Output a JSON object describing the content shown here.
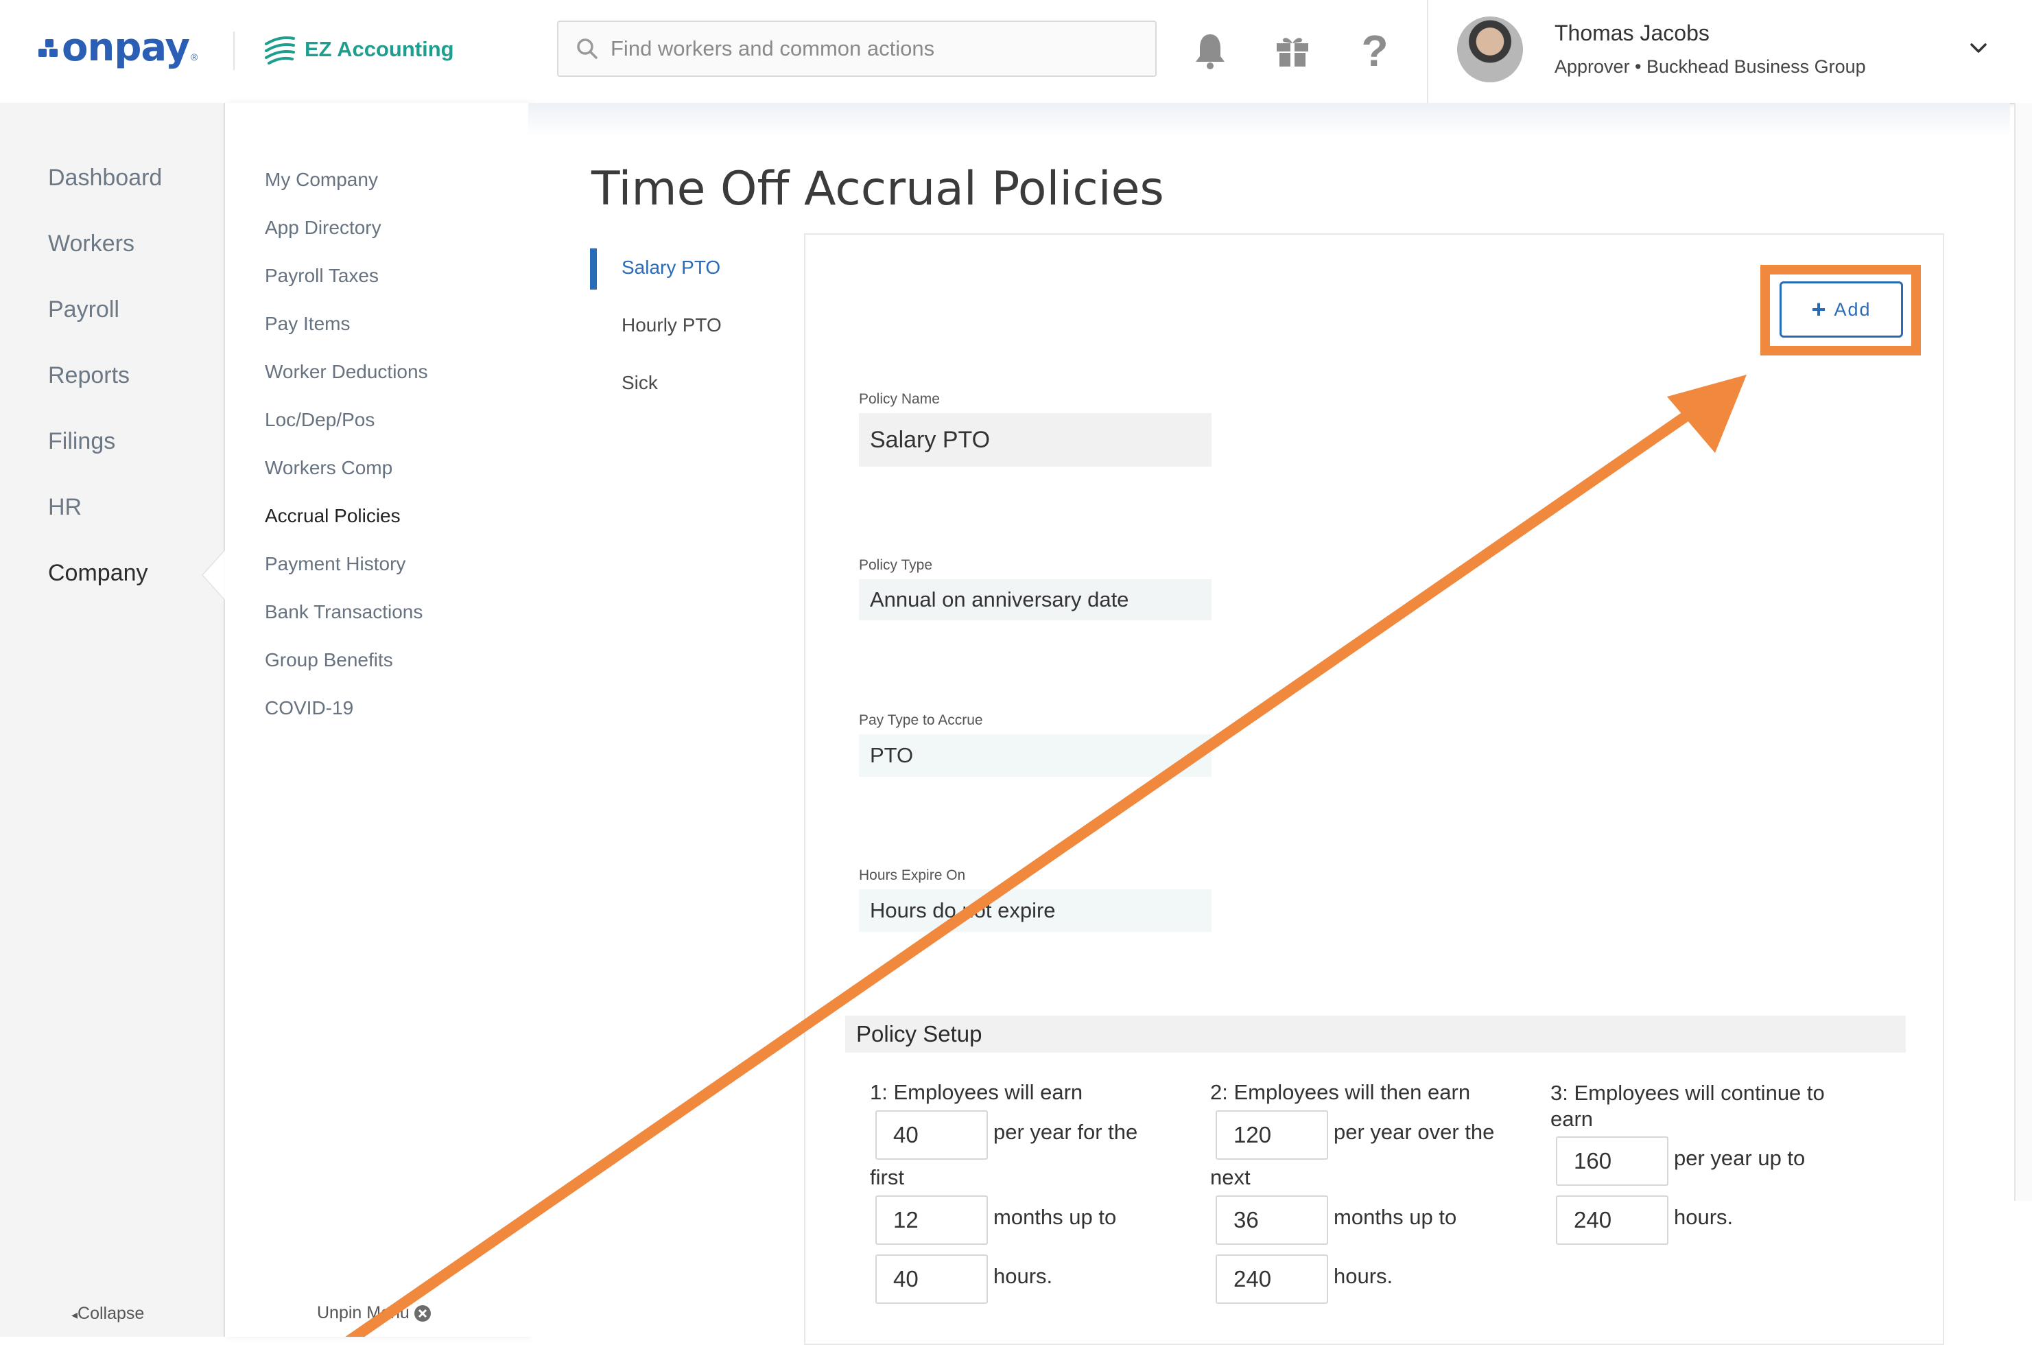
{
  "header": {
    "onpay_logo": "onpay",
    "onpay_logo_reg": "®",
    "ez_logo": "EZ Accounting",
    "search_placeholder": "Find workers and common actions",
    "icons": [
      "bell-icon",
      "gift-icon",
      "help-icon"
    ],
    "help_glyph": "?",
    "user_name": "Thomas Jacobs",
    "user_role": "Approver • Buckhead Business Group"
  },
  "nav_primary": {
    "items": [
      {
        "label": "Dashboard"
      },
      {
        "label": "Workers"
      },
      {
        "label": "Payroll"
      },
      {
        "label": "Reports"
      },
      {
        "label": "Filings"
      },
      {
        "label": "HR"
      },
      {
        "label": "Company"
      }
    ],
    "active": "Company",
    "collapse_label": "Collapse"
  },
  "nav_secondary": {
    "items": [
      {
        "label": "My Company"
      },
      {
        "label": "App Directory"
      },
      {
        "label": "Payroll Taxes"
      },
      {
        "label": "Pay Items"
      },
      {
        "label": "Worker Deductions"
      },
      {
        "label": "Loc/Dep/Pos"
      },
      {
        "label": "Workers Comp"
      },
      {
        "label": "Accrual Policies"
      },
      {
        "label": "Payment History"
      },
      {
        "label": "Bank Transactions"
      },
      {
        "label": "Group Benefits"
      },
      {
        "label": "COVID-19"
      }
    ],
    "active": "Accrual Policies",
    "unpin_label": "Unpin Menu"
  },
  "main": {
    "title": "Time Off Accrual Policies",
    "policy_tabs": [
      {
        "label": "Salary PTO"
      },
      {
        "label": "Hourly PTO"
      },
      {
        "label": "Sick"
      }
    ],
    "active_tab": "Salary PTO",
    "add_button": "Add",
    "fields": {
      "policy_name": {
        "label": "Policy Name",
        "value": "Salary PTO"
      },
      "policy_type": {
        "label": "Policy Type",
        "value": "Annual on anniversary date"
      },
      "pay_type": {
        "label": "Pay Type to Accrue",
        "value": "PTO"
      },
      "hours_expire": {
        "label": "Hours Expire On",
        "value": "Hours do not expire"
      }
    },
    "setup": {
      "title": "Policy Setup",
      "tiers": [
        {
          "heading": "1: Employees will earn",
          "rate": "40",
          "rate_suffix": "per year for the",
          "period_prefix": "first",
          "months": "12",
          "months_suffix": "months up to",
          "cap": "40",
          "cap_suffix": "hours."
        },
        {
          "heading": "2: Employees will then earn",
          "rate": "120",
          "rate_suffix": "per year over the",
          "period_prefix": "next",
          "months": "36",
          "months_suffix": "months up to",
          "cap": "240",
          "cap_suffix": "hours."
        },
        {
          "heading": "3: Employees will continue to earn",
          "rate": "160",
          "rate_suffix": "per year up to",
          "cap": "240",
          "cap_suffix": "hours."
        }
      ]
    }
  },
  "colors": {
    "brand_blue": "#2a5fb5",
    "link_blue": "#2a6bb8",
    "ez_teal": "#1e9e8f",
    "highlight_orange": "#f0883d"
  }
}
